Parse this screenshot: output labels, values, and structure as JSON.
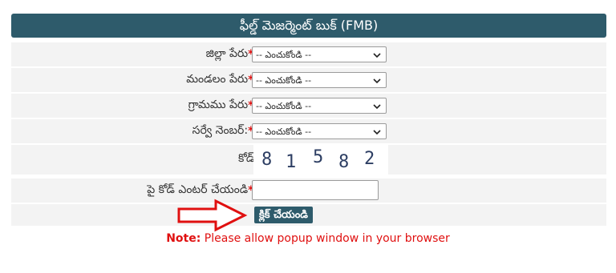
{
  "header": {
    "title": "ఫీల్డ్ మెజర్మెంట్ బుక్ (FMB)"
  },
  "form": {
    "district": {
      "label": "జిల్లా పేరు",
      "required_mark": "*:",
      "selected": "-- ఎంచుకోండి --"
    },
    "mandal": {
      "label": "మండలం పేరు",
      "required_mark": "*:",
      "selected": "-- ఎంచుకోండి --"
    },
    "village": {
      "label": "గ్రామము పేరు",
      "required_mark": "*:",
      "selected": "-- ఎంచుకోండి --"
    },
    "survey": {
      "label": "సర్వే నెంబర్: ",
      "required_mark": "*:",
      "selected": "-- ఎంచుకోండి --"
    },
    "captcha": {
      "label": "కోడ్:",
      "chars": [
        "8",
        "1",
        "5",
        "8",
        "2"
      ]
    },
    "code_entry": {
      "label": "పై కోడ్ ఎంటర్ చేయండి",
      "required_mark": "*:",
      "value": ""
    },
    "submit_label": "క్లిక్ చేయండి"
  },
  "note": {
    "prefix": "Note:",
    "text": " Please allow popup window in your browser"
  },
  "colors": {
    "header_bg": "#2e5b6b",
    "row_bg": "#f3f3f3",
    "required": "#e01010",
    "arrow": "#e01010"
  },
  "icons": {
    "dropdown": "chevron-down-icon",
    "pointer": "arrow-right-icon"
  }
}
